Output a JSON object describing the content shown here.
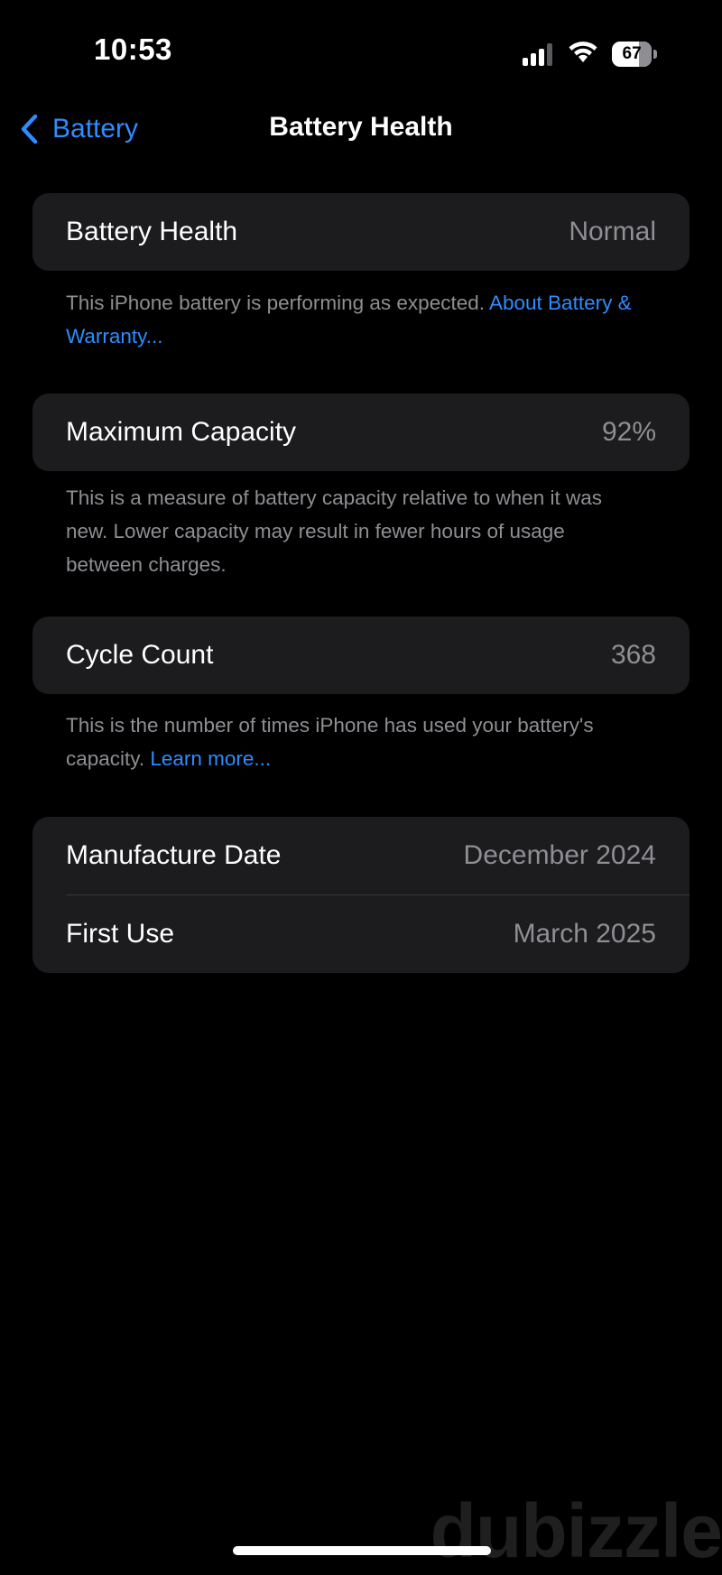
{
  "status_bar": {
    "time": "10:53",
    "battery_level": "67",
    "battery_fraction": 0.67,
    "icons": [
      "signal-icon",
      "wifi-icon",
      "battery-icon"
    ]
  },
  "nav": {
    "back_label": "Battery",
    "title": "Battery Health"
  },
  "sections": {
    "health": {
      "label": "Battery Health",
      "value": "Normal",
      "footnote_text": "This iPhone battery is performing as expected. ",
      "footnote_link": "About Battery & Warranty..."
    },
    "capacity": {
      "label": "Maximum Capacity",
      "value": "92%",
      "footnote_text": "This is a measure of battery capacity relative to when it was new. Lower capacity may result in fewer hours of usage between charges."
    },
    "cycles": {
      "label": "Cycle Count",
      "value": "368",
      "footnote_text": "This is the number of times iPhone has used your battery's capacity. ",
      "footnote_link": "Learn more..."
    },
    "dates": {
      "manufacture_label": "Manufacture Date",
      "manufacture_value": "December 2024",
      "first_use_label": "First Use",
      "first_use_value": "March 2025"
    }
  },
  "watermark": "dubizzle",
  "colors": {
    "background": "#000000",
    "card": "#1c1c1e",
    "accent": "#2f8cff",
    "secondary_text": "#8e8e93"
  }
}
